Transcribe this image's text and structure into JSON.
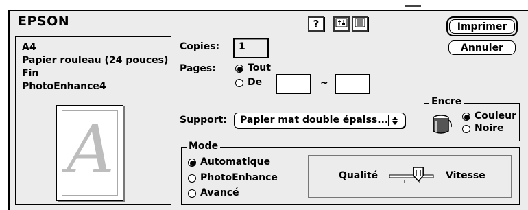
{
  "brand": "EPSON",
  "toolbar": {
    "help_label": "?",
    "icons": [
      "help-icon",
      "tools-icon",
      "printer-icon"
    ]
  },
  "actions": {
    "print_label": "Imprimer",
    "cancel_label": "Annuler"
  },
  "summary": {
    "lines": [
      "A4",
      "Papier rouleau (24 pouces)",
      "Fin",
      "PhotoEnhance4"
    ],
    "preview_letter": "A"
  },
  "copies": {
    "label": "Copies:",
    "value": "1"
  },
  "pages": {
    "label": "Pages:",
    "options": [
      "Tout",
      "De"
    ],
    "selected": "Tout",
    "from_value": "",
    "to_value": "",
    "range_separator": "~"
  },
  "support": {
    "label": "Support:",
    "value": "Papier mat double épaiss..."
  },
  "ink": {
    "legend": "Encre",
    "options": [
      "Couleur",
      "Noire"
    ],
    "selected": "Couleur",
    "icon": "ink-cartridge-icon"
  },
  "mode": {
    "legend": "Mode",
    "options": [
      "Automatique",
      "PhotoEnhance",
      "Avancé"
    ],
    "selected": "Automatique",
    "slider": {
      "left_label": "Qualité",
      "right_label": "Vitesse",
      "position": 0.67
    }
  }
}
